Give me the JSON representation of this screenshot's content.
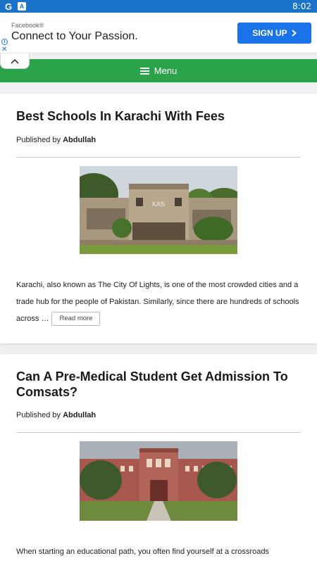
{
  "status_bar": {
    "time": "8:02",
    "app_icons": [
      "google-icon",
      "app-a-icon"
    ]
  },
  "ad": {
    "source": "Facebook®",
    "headline": "Connect to Your Passion.",
    "cta_label": "SIGN UP",
    "cta_color": "#1a73e8"
  },
  "nav": {
    "menu_label": "Menu",
    "bar_color": "#2aa34a"
  },
  "posts": [
    {
      "title": "Best Schools In Karachi With Fees",
      "byline_prefix": "Published by",
      "author": "Abdullah",
      "image_desc": "school-building-photo",
      "image_sign": "KAS",
      "excerpt": "Karachi, also known as The City Of Lights, is one of the most crowded cities and a trade hub for the people of Pakistan. Similarly, since there are hundreds of schools across …",
      "read_more": "Read more"
    },
    {
      "title": "Can A Pre-Medical Student Get Admission To Comsats?",
      "byline_prefix": "Published by",
      "author": "Abdullah",
      "image_desc": "university-building-photo",
      "excerpt": "When starting an educational path, you often find yourself at a crossroads"
    }
  ]
}
